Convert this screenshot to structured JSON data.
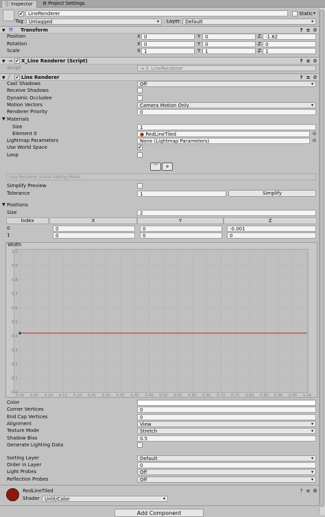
{
  "tabs": [
    "Inspector",
    "Project Settings"
  ],
  "gameobject": {
    "name": "LineRenderer",
    "static_label": "Static",
    "tag_label": "Tag",
    "tag_value": "Untagged",
    "layer_label": "Layer",
    "layer_value": "Default"
  },
  "transform": {
    "title": "Transform",
    "position_label": "Position",
    "rotation_label": "Rotation",
    "scale_label": "Scale",
    "axis_x": "X",
    "axis_y": "Y",
    "axis_z": "Z",
    "position": [
      "0",
      "0",
      "-1.82"
    ],
    "rotation": [
      "0",
      "0",
      "0"
    ],
    "scale": [
      "1",
      "1",
      "1"
    ]
  },
  "script_component": {
    "title": "X_Line Renderer (Script)",
    "script_label": "Script",
    "script_value": "X_LineRenderer"
  },
  "line_renderer": {
    "title": "Line Renderer",
    "cast_shadows_label": "Cast Shadows",
    "cast_shadows_value": "Off",
    "receive_shadows_label": "Receive Shadows",
    "dynamic_occludee_label": "Dynamic Occludee",
    "motion_vectors_label": "Motion Vectors",
    "motion_vectors_value": "Camera Motion Only",
    "renderer_priority_label": "Renderer Priority",
    "renderer_priority_value": "0",
    "materials_label": "Materials",
    "size_label": "Size",
    "size_value": "1",
    "element0_label": "Element 0",
    "element0_value": "RedLineTiled",
    "lightmap_params_label": "Lightmap Parameters",
    "lightmap_params_value": "None (Lightmap Parameters)",
    "use_world_space_label": "Use World Space",
    "loop_label": "Loop",
    "editing_mode_text": "Line Renderer Scene Editing Mode:",
    "simplify_preview_label": "Simplify Preview",
    "tolerance_label": "Tolerance",
    "tolerance_value": "1",
    "simplify_button": "Simplify",
    "positions_label": "Positions",
    "positions_size_label": "Size",
    "positions_size_value": "2",
    "table_headers": [
      "Index",
      "X",
      "Y",
      "Z"
    ],
    "table_rows": [
      [
        "0",
        "0",
        "0",
        "-0.001"
      ],
      [
        "1",
        "0",
        "0",
        "0"
      ]
    ],
    "width_label": "Width",
    "color_label": "Color",
    "corner_vertices_label": "Corner Vertices",
    "corner_vertices_value": "0",
    "end_cap_vertices_label": "End Cap Vertices",
    "end_cap_vertices_value": "0",
    "alignment_label": "Alignment",
    "alignment_value": "View",
    "texture_mode_label": "Texture Mode",
    "texture_mode_value": "Stretch",
    "shadow_bias_label": "Shadow Bias",
    "shadow_bias_value": "0.5",
    "generate_lighting_label": "Generate Lighting Data",
    "sorting_layer_label": "Sorting Layer",
    "sorting_layer_value": "Default",
    "order_in_layer_label": "Order in Layer",
    "order_in_layer_value": "0",
    "light_probes_label": "Light Probes",
    "light_probes_value": "Off",
    "reflection_probes_label": "Reflection Probes",
    "reflection_probes_value": "Off"
  },
  "width_curve": {
    "y_ticks": [
      "1.0",
      "0.9",
      "0.8",
      "0.7",
      "0.6",
      "0.5",
      "0.4",
      "0.3",
      "0.2",
      "0.1",
      "0.0"
    ],
    "x_ticks": [
      "0.00",
      "0.05",
      "0.10",
      "0.15",
      "0.20",
      "0.25",
      "0.30",
      "0.35",
      "0.40",
      "0.45",
      "0.50",
      "0.55",
      "0.60",
      "0.65",
      "0.70",
      "0.75",
      "0.80",
      "0.85",
      "0.90",
      "0.95",
      "1.00"
    ],
    "curve_value": 0.42,
    "curve_color": "#c8191e"
  },
  "material": {
    "name": "RedLineTiled",
    "shader_label": "Shader",
    "shader_value": "Unlit/Color",
    "swatch_color": "#8a1a0e"
  },
  "add_component_label": "Add Component"
}
